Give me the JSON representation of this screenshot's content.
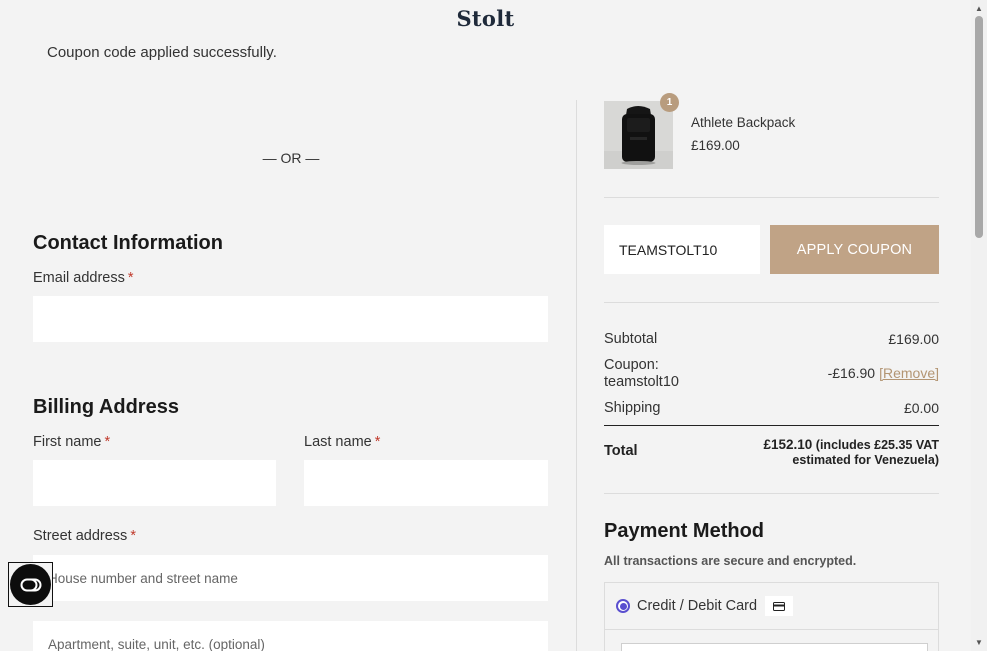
{
  "brand": "Stolt",
  "notice": "Coupon code applied successfully.",
  "divider_or": "— OR —",
  "contact": {
    "heading": "Contact Information",
    "email_label": "Email address",
    "required_mark": "*"
  },
  "billing": {
    "heading": "Billing Address",
    "first_name_label": "First name",
    "last_name_label": "Last name",
    "street_label": "Street address",
    "street_placeholder": "House number and street name",
    "apartment_placeholder": "Apartment, suite, unit, etc. (optional)"
  },
  "cart": {
    "item": {
      "name": "Athlete Backpack",
      "price": "£169.00",
      "quantity": "1"
    }
  },
  "coupon": {
    "value": "TEAMSTOLT10",
    "button": "APPLY COUPON"
  },
  "summary": {
    "subtotal_label": "Subtotal",
    "subtotal_value": "£169.00",
    "coupon_label_line1": "Coupon:",
    "coupon_label_line2": "teamstolt10",
    "coupon_value": "-£16.90",
    "remove_label": "[Remove]",
    "shipping_label": "Shipping",
    "shipping_value": "£0.00",
    "total_label": "Total",
    "total_amount": "£152.10",
    "total_note_line1": "(includes £25.35 VAT",
    "total_note_line2": "estimated for Venezuela)"
  },
  "payment": {
    "heading": "Payment Method",
    "subtitle": "All transactions are secure and encrypted.",
    "option_label": "Credit / Debit Card"
  },
  "icons": {
    "chat": "chat-icon",
    "card": "credit-card-icon",
    "product": "backpack-image"
  },
  "colors": {
    "accent": "#c0a386",
    "badge": "#b89c7e",
    "radio": "#5a4fcf",
    "background": "#f3f3f3"
  }
}
